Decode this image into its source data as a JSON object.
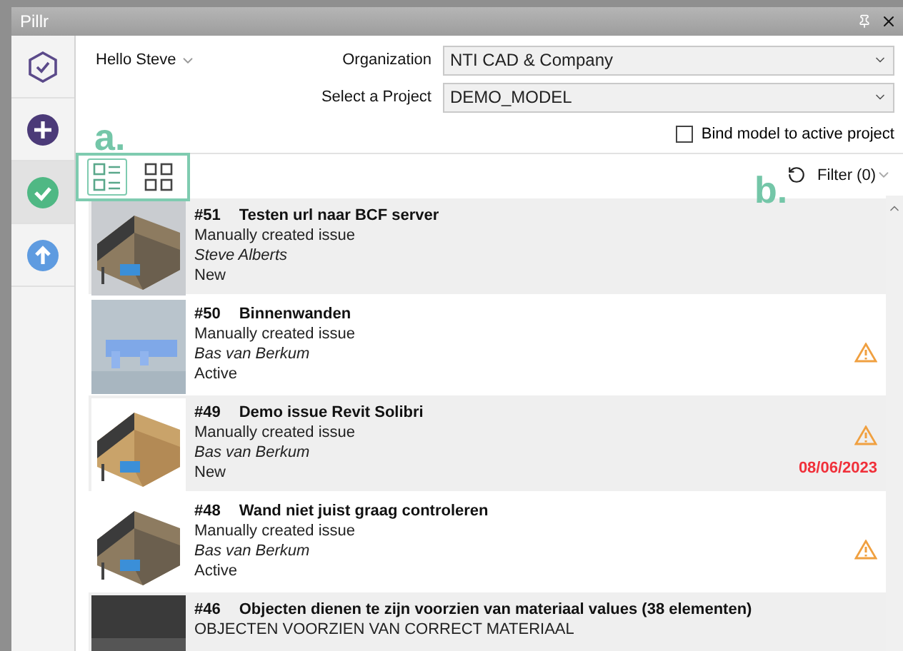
{
  "window": {
    "title": "Pillr"
  },
  "sidebar": {
    "items": [
      {
        "kind": "logo",
        "selected": false
      },
      {
        "kind": "add",
        "selected": false
      },
      {
        "kind": "issues",
        "selected": true
      },
      {
        "kind": "upload",
        "selected": false
      }
    ]
  },
  "header": {
    "greeting": "Hello Steve",
    "organization_label": "Organization",
    "organization": "NTI CAD & Company",
    "project_label": "Select a Project",
    "project": "DEMO_MODEL",
    "bind_label": "Bind model to active project",
    "bind_checked": false
  },
  "annotations": [
    "a.",
    "b."
  ],
  "toolbar": {
    "views": [
      {
        "kind": "list",
        "selected": true
      },
      {
        "kind": "grid",
        "selected": false
      }
    ],
    "filter": "Filter (0)"
  },
  "issues": [
    {
      "number": "#51",
      "title": "Testen url naar BCF server",
      "description": "Manually created issue",
      "author": "Steve Alberts",
      "status": "New",
      "warning": false
    },
    {
      "number": "#50",
      "title": "Binnenwanden",
      "description": "Manually created issue",
      "author": "Bas van Berkum",
      "status": "Active",
      "warning": true
    },
    {
      "number": "#49",
      "title": "Demo issue Revit Solibri",
      "description": "Manually created issue",
      "author": "Bas van Berkum",
      "status": "New",
      "warning": true,
      "due_date": "08/06/2023"
    },
    {
      "number": "#48",
      "title": "Wand niet juist graag controleren",
      "description": "Manually created issue",
      "author": "Bas van Berkum",
      "status": "Active",
      "warning": true
    },
    {
      "number": "#46",
      "title": "Objecten dienen te zijn voorzien van materiaal  values (38 elementen)",
      "description": "OBJECTEN VOORZIEN VAN CORRECT MATERIAAL",
      "warning": false
    }
  ]
}
